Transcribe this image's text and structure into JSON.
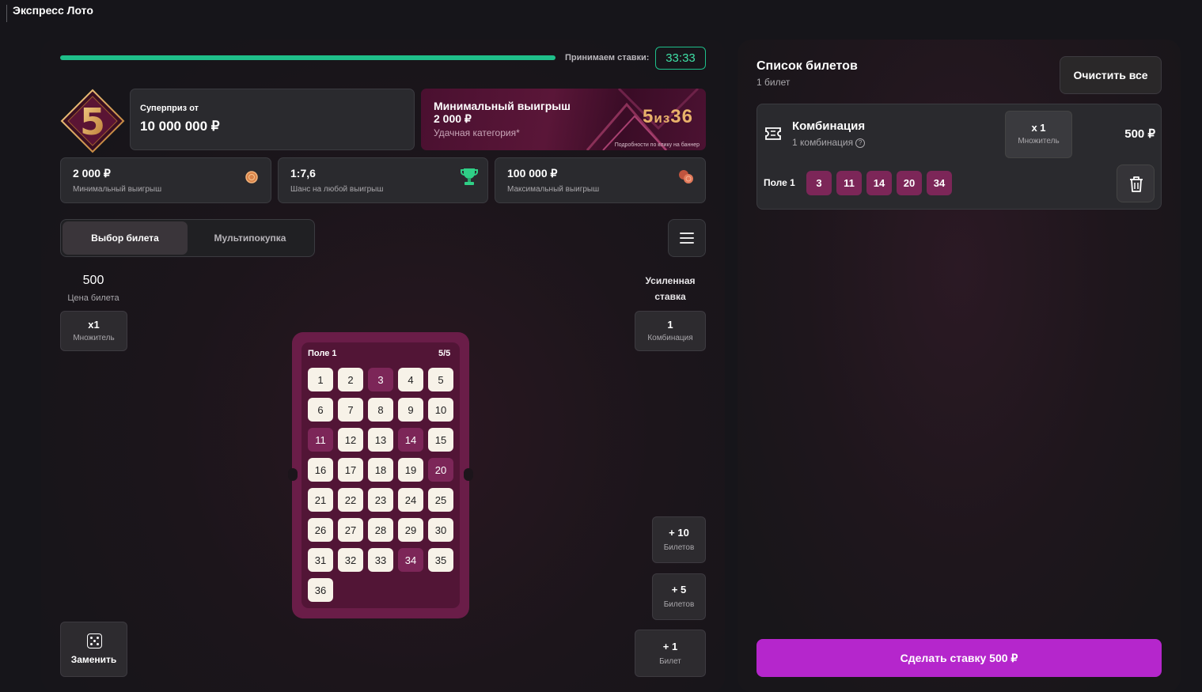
{
  "app": {
    "title": "Экспресс Лото"
  },
  "timer": {
    "label": "Принимаем ставки:",
    "value": "33:33",
    "progress": 1.0
  },
  "badge": {
    "value": "5"
  },
  "superprize": {
    "label": "Суперприз от",
    "value": "10 000 000 ₽"
  },
  "banner": {
    "title": "Минимальный выигрыш 2 000 ₽",
    "subtitle": "Удачная категория*",
    "logo_a": "5",
    "logo_b": "из",
    "logo_c": "36",
    "note": "Подробности по клику на баннер"
  },
  "stats": [
    {
      "value": "2 000 ₽",
      "label": "Минимальный выигрыш",
      "icon": "coin-icon"
    },
    {
      "value": "1:7,6",
      "label": "Шанс на любой выигрыш",
      "icon": "trophy-icon"
    },
    {
      "value": "100 000 ₽",
      "label": "Максимальный выигрыш",
      "icon": "coins-stack-icon"
    }
  ],
  "tabs": [
    {
      "label": "Выбор билета",
      "active": true
    },
    {
      "label": "Мультипокупка",
      "active": false
    }
  ],
  "ticket_price": {
    "value": "500",
    "label": "Цена билета"
  },
  "multiplier": {
    "value": "x1",
    "label": "Множитель"
  },
  "boost": {
    "label": "Усиленная ставка",
    "value": "1",
    "sub": "Комбинация"
  },
  "field": {
    "label": "Поле 1",
    "count": "5/5",
    "numbers": [
      "1",
      "2",
      "3",
      "4",
      "5",
      "6",
      "7",
      "8",
      "9",
      "10",
      "11",
      "12",
      "13",
      "14",
      "15",
      "16",
      "17",
      "18",
      "19",
      "20",
      "21",
      "22",
      "23",
      "24",
      "25",
      "26",
      "27",
      "28",
      "29",
      "30",
      "31",
      "32",
      "33",
      "34",
      "35",
      "36"
    ],
    "selected": [
      "3",
      "11",
      "14",
      "20",
      "34"
    ]
  },
  "add_buttons": [
    {
      "value": "+ 10",
      "label": "Билетов"
    },
    {
      "value": "+ 5",
      "label": "Билетов"
    },
    {
      "value": "+ 1",
      "label": "Билет"
    }
  ],
  "replace": {
    "label": "Заменить"
  },
  "ticket_list": {
    "title": "Список билетов",
    "count": "1 билет",
    "clear_label": "Очистить все",
    "item": {
      "title": "Комбинация",
      "sub": "1 комбинация",
      "mult_value": "x 1",
      "mult_label": "Множитель",
      "price": "500 ₽",
      "field_label": "Поле 1",
      "numbers": [
        "3",
        "11",
        "14",
        "20",
        "34"
      ]
    }
  },
  "bet_button": {
    "label": "Сделать ставку 500 ₽"
  },
  "colors": {
    "accent": "#b526cc",
    "selected": "#7c2658",
    "timer": "#1fbf8a"
  }
}
